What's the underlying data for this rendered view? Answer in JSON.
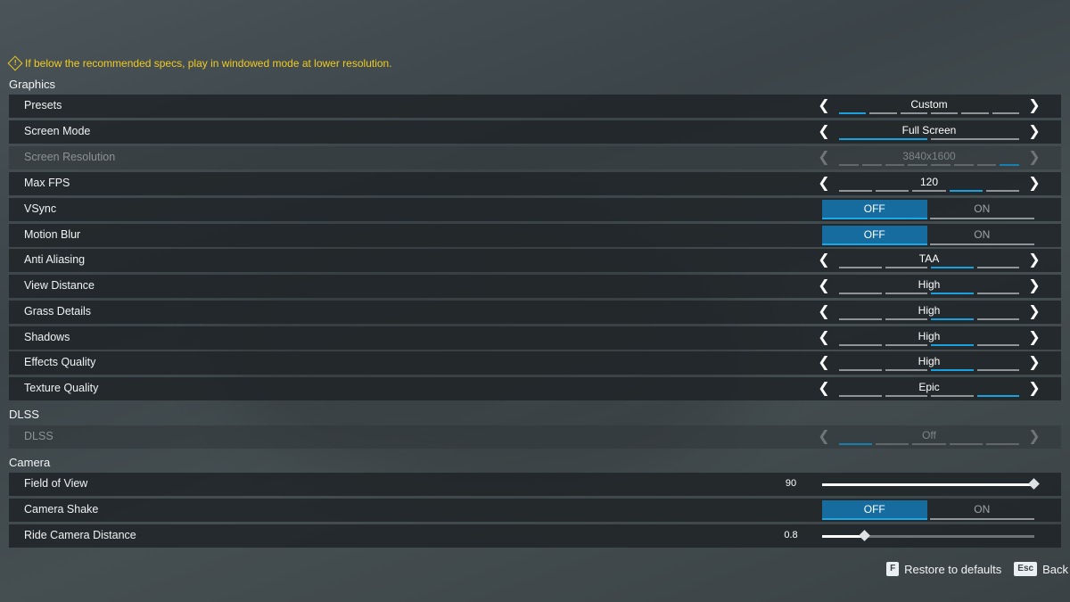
{
  "warning": {
    "icon": "warning-diamond-icon",
    "text": "If below the recommended specs, play in windowed mode at lower resolution."
  },
  "sections": {
    "graphics": "Graphics",
    "dlss": "DLSS",
    "camera": "Camera"
  },
  "settings": {
    "presets": {
      "label": "Presets",
      "value": "Custom",
      "segments": 6,
      "active": 0
    },
    "screen_mode": {
      "label": "Screen Mode",
      "value": "Full Screen",
      "segments": 2,
      "active": 0
    },
    "screen_resolution": {
      "label": "Screen Resolution",
      "value": "3840x1600",
      "segments": 8,
      "active": 7,
      "disabled": true
    },
    "max_fps": {
      "label": "Max FPS",
      "value": "120",
      "segments": 5,
      "active": 3
    },
    "vsync": {
      "label": "VSync",
      "options": [
        "OFF",
        "ON"
      ],
      "selected": 0
    },
    "motion_blur": {
      "label": "Motion Blur",
      "options": [
        "OFF",
        "ON"
      ],
      "selected": 0
    },
    "anti_aliasing": {
      "label": "Anti Aliasing",
      "value": "TAA",
      "segments": 4,
      "active": 2
    },
    "view_distance": {
      "label": "View Distance",
      "value": "High",
      "segments": 4,
      "active": 2
    },
    "grass_details": {
      "label": "Grass Details",
      "value": "High",
      "segments": 4,
      "active": 2
    },
    "shadows": {
      "label": "Shadows",
      "value": "High",
      "segments": 4,
      "active": 2
    },
    "effects_quality": {
      "label": "Effects Quality",
      "value": "High",
      "segments": 4,
      "active": 2
    },
    "texture_quality": {
      "label": "Texture Quality",
      "value": "Epic",
      "segments": 4,
      "active": 3
    },
    "dlss": {
      "label": "DLSS",
      "value": "Off",
      "segments": 5,
      "active": 0,
      "disabled": true
    },
    "field_of_view": {
      "label": "Field of View",
      "value": "90",
      "fraction": 1.0
    },
    "camera_shake": {
      "label": "Camera Shake",
      "options": [
        "OFF",
        "ON"
      ],
      "selected": 0
    },
    "ride_camera_distance": {
      "label": "Ride Camera Distance",
      "value": "0.8",
      "fraction": 0.2
    }
  },
  "footer": {
    "restore": {
      "key": "F",
      "label": "Restore to defaults"
    },
    "back": {
      "key": "Esc",
      "label": "Back"
    }
  },
  "colors": {
    "accent": "#1aa0dd",
    "toggle_on": "#166c9f",
    "warning": "#f1cb1f"
  }
}
